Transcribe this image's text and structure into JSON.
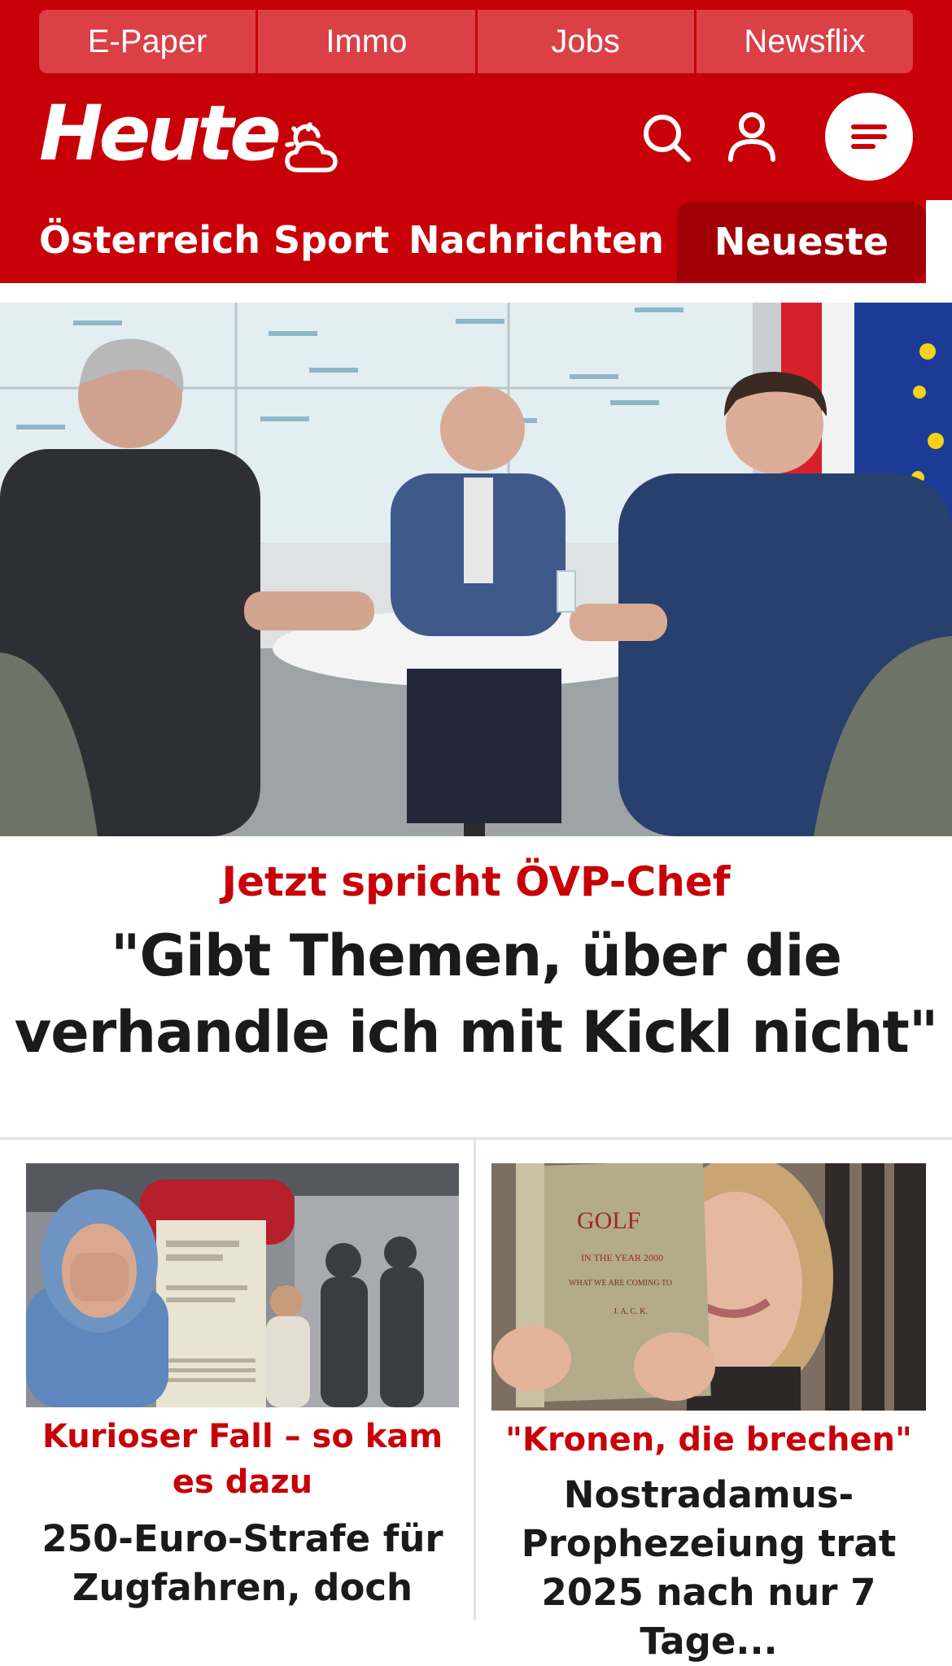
{
  "top_links": [
    "E-Paper",
    "Immo",
    "Jobs",
    "Newsflix"
  ],
  "header": {
    "logo_text": "Heute",
    "icons": [
      "weather-icon",
      "search-icon",
      "user-icon",
      "menu-icon"
    ]
  },
  "nav": {
    "items": [
      "Österreich",
      "Sport",
      "Nachrichten"
    ],
    "active": "Neueste"
  },
  "colors": {
    "brand_red": "#c80008",
    "dark_red": "#a10006",
    "top_link_bg": "#db4046",
    "text": "#1a1a1a"
  },
  "hero": {
    "image_alt": "Interview at round table in Volkspartei studio",
    "kicker": "Jetzt spricht ÖVP-Chef",
    "headline": "\"Gibt Themen, über die verhandle ich mit Kickl nicht\""
  },
  "teasers": [
    {
      "image_alt": "Man covering face beside train station crowd and fine notice",
      "kicker": "Kurioser Fall – so kam es dazu",
      "headline": "250-Euro-Strafe für Zugfahren, doch"
    },
    {
      "image_alt": "Woman holding old book titled Golf in the year 2000",
      "kicker": "\"Kronen, die brechen\"",
      "headline": "Nostradamus-Prophezeiung trat 2025 nach nur 7 Tage..."
    }
  ]
}
